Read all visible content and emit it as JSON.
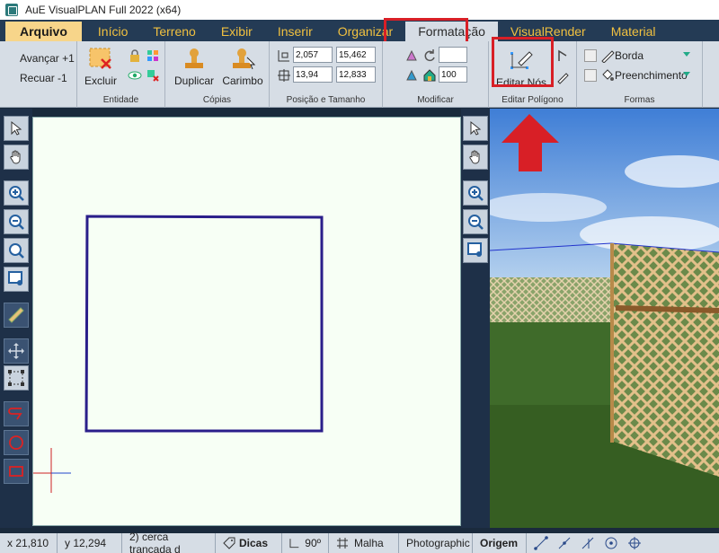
{
  "window": {
    "title": "AuE VisualPLAN Full 2022 (x64)"
  },
  "tabs": [
    {
      "label": "Arquivo"
    },
    {
      "label": "Início"
    },
    {
      "label": "Terreno"
    },
    {
      "label": "Exibir"
    },
    {
      "label": "Inserir"
    },
    {
      "label": "Organizar"
    },
    {
      "label": "Formatação"
    },
    {
      "label": "VisualRender"
    },
    {
      "label": "Material"
    }
  ],
  "ribbon": {
    "undo": {
      "forward": "Avançar +1",
      "back": "Recuar -1"
    },
    "entidade": {
      "excluir": "Excluir",
      "label": "Entidade"
    },
    "copias": {
      "duplicar": "Duplicar",
      "carimbo": "Carimbo",
      "label": "Cópias"
    },
    "posicao": {
      "x": "2,057",
      "y": "15,462",
      "w": "13,94",
      "h": "12,833",
      "label": "Posição e Tamanho"
    },
    "modificar": {
      "value": "100",
      "label": "Modificar"
    },
    "editar_poligono": {
      "editar_nos": "Editar Nós",
      "label": "Editar Polígono"
    },
    "formas": {
      "borda": "Borda",
      "preenchimento": "Preenchimento",
      "label": "Formas"
    }
  },
  "status": {
    "x": "x 21,810",
    "y": "y 12,294",
    "selection": "2) cerca trançada d",
    "dicas": "Dicas",
    "angle": "90º",
    "malha": "Malha",
    "render": "Photographic",
    "origem": "Origem"
  },
  "colors": {
    "highlight": "#d81f26",
    "accent": "#f0c040",
    "dark": "#243b55",
    "ribbon": "#d6dde5"
  }
}
